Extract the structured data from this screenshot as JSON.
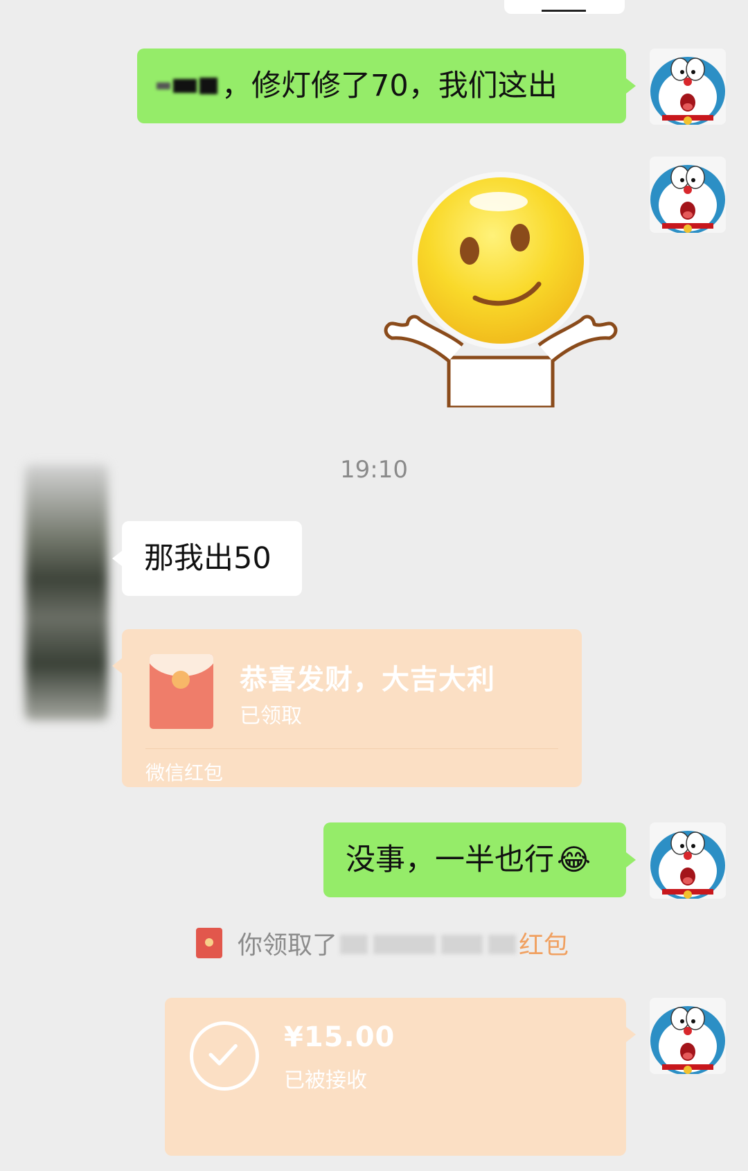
{
  "messages": {
    "m1_text_visible": "，修灯修了70，我们这出",
    "timestamp": "19:10",
    "m2_text": "那我出50",
    "m3_title": "恭喜发财，大吉大利",
    "m3_status": "已领取",
    "m3_footer": "微信红包",
    "m4_text": "没事，一半也行",
    "m4_emoji": "😂",
    "m5_prefix": "你领取了",
    "m5_suffix": "红包",
    "m6_amount": "¥15.00",
    "m6_status": "已被接收"
  },
  "icons": {
    "self_avatar": "doraemon-avatar-icon",
    "other_avatar": "blurred-avatar",
    "sticker": "smiley-shrug-sticker",
    "red_packet": "red-packet-icon",
    "transfer": "check-circle-icon"
  },
  "colors": {
    "chat_background": "#ededed",
    "self_bubble": "#95ec69",
    "other_bubble": "#ffffff",
    "packet_background": "#fbdfc4",
    "accent_orange": "#f0a060"
  }
}
